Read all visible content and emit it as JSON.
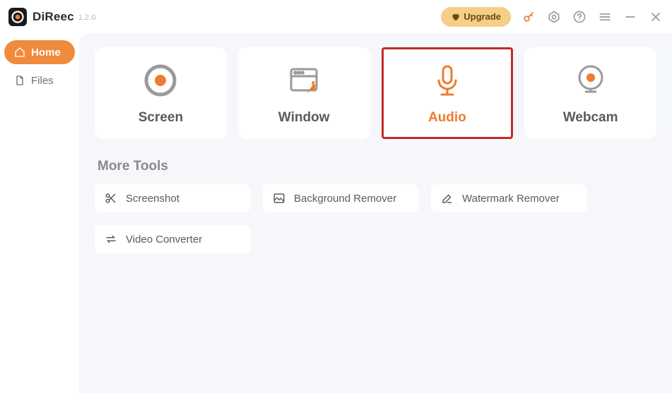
{
  "app": {
    "name": "DiReec",
    "version": "1.2.0"
  },
  "titlebar": {
    "upgrade_label": "Upgrade"
  },
  "sidebar": {
    "items": [
      {
        "label": "Home",
        "active": true
      },
      {
        "label": "Files",
        "active": false
      }
    ]
  },
  "main": {
    "cards": [
      {
        "label": "Screen",
        "selected": false
      },
      {
        "label": "Window",
        "selected": false
      },
      {
        "label": "Audio",
        "selected": true
      },
      {
        "label": "Webcam",
        "selected": false
      }
    ],
    "more_tools_title": "More Tools",
    "tools": [
      {
        "label": "Screenshot"
      },
      {
        "label": "Background Remover"
      },
      {
        "label": "Watermark Remover"
      },
      {
        "label": "Video Converter"
      }
    ]
  },
  "colors": {
    "accent": "#ee7b2f"
  }
}
